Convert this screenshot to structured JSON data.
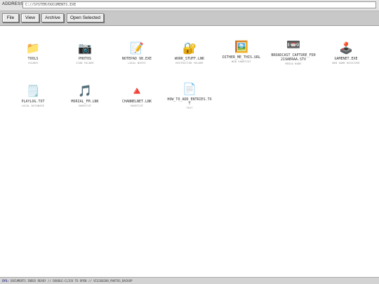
{
  "address": {
    "label": "ADDRESS",
    "value": "C://SYSTEM/DOCUMENTS.EXE"
  },
  "toolbar": {
    "buttons": [
      "File",
      "View",
      "Archive",
      "Open Selected"
    ]
  },
  "items": [
    {
      "name": "TOOLS",
      "type": "FOLDER",
      "icon": "📁",
      "icon_name": "folder-icon"
    },
    {
      "name": "PHOTOS",
      "type": "ICON FOLDER",
      "icon": "📷",
      "icon_name": "camera-icon"
    },
    {
      "name": "NOTEPAD 98.EXE",
      "type": "LOCAL NOTES",
      "icon": "📝",
      "icon_name": "notepad-icon"
    },
    {
      "name": "WORK_STUFF.LNK",
      "type": "RESTRICTED FOLDER",
      "icon": "🔐",
      "icon_name": "lock-icon"
    },
    {
      "name": "DITHER_ME_THIS.URL",
      "type": "WEB SHORTCUT",
      "icon": "🖼️",
      "icon_name": "picture-icon"
    },
    {
      "name": "BROADCAST_CAPTURE_FD0219AB4AA.STV",
      "type": "MEDIA NODE",
      "icon": "📼",
      "icon_name": "videotape-icon"
    },
    {
      "name": "GAMENET.EXE",
      "type": "WEB GAME RECEIVER",
      "icon": "🕹️",
      "icon_name": "joystick-icon"
    },
    {
      "name": "PLAYLOG.TXT",
      "type": "LOCAL DATABASE",
      "icon": "🗒️",
      "icon_name": "log-icon"
    },
    {
      "name": "MORIAL_FM.LNK",
      "type": "SHORTCUT",
      "icon": "🎵",
      "icon_name": "music-note-icon"
    },
    {
      "name": "CHANNELNET.LNK",
      "type": "SHORTCUT",
      "icon": "🔺",
      "icon_name": "triangle-icon"
    },
    {
      "name": "HOW_TO_ADD_ENTRIES.TXT",
      "type": "TEXT",
      "icon": "📄",
      "icon_name": "document-icon"
    }
  ],
  "status": {
    "prefix": "SYS:",
    "text": "DOCUMENTS INDEX READY // DOUBLE-CLICK TO OPEN // VIS260208_PHOTOS_BACKUP"
  }
}
